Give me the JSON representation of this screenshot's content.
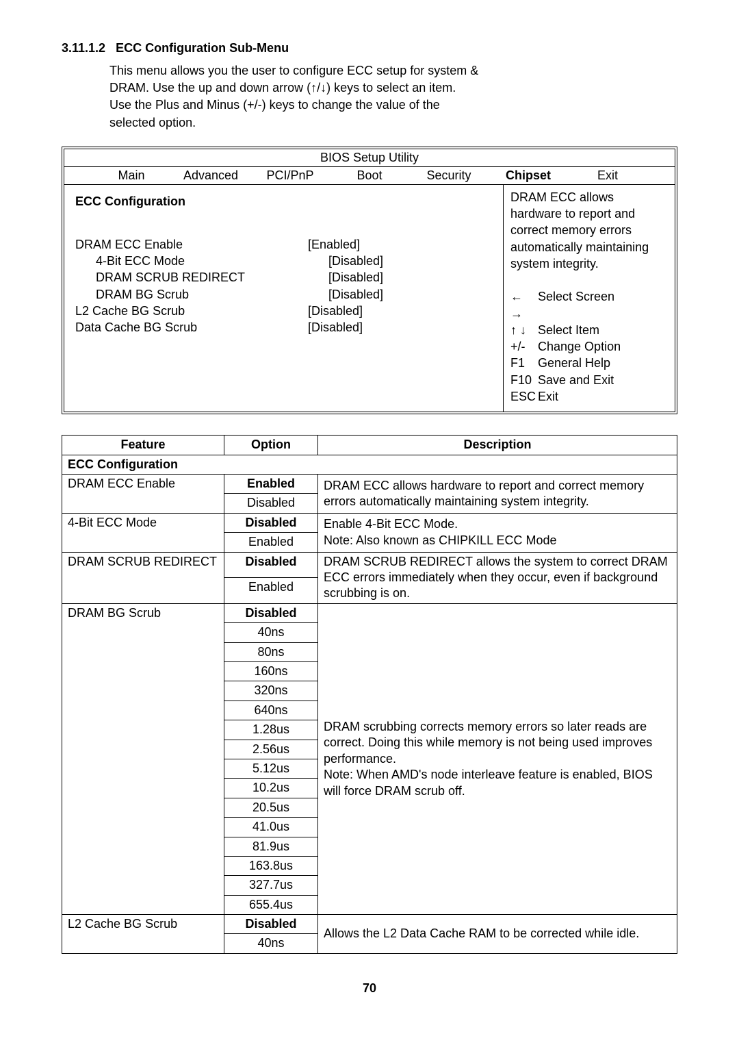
{
  "heading_number": "3.11.1.2",
  "heading_title": "ECC Configuration Sub-Menu",
  "intro_line1": "This menu allows you the user to configure ECC setup for system &",
  "intro_line2a": "DRAM. Use the up and down arrow (",
  "intro_line2b": ") keys to select an item.",
  "intro_line3": "Use the Plus and Minus (+/-) keys to change the value of the",
  "intro_line4": "selected option.",
  "bios_title": "BIOS Setup Utility",
  "menu": {
    "main": "Main",
    "advanced": "Advanced",
    "pcipnp": "PCI/PnP",
    "boot": "Boot",
    "security": "Security",
    "chipset": "Chipset",
    "exit": "Exit"
  },
  "panel_section": "ECC Configuration",
  "options": [
    {
      "label": "DRAM ECC Enable",
      "value": "[Enabled]",
      "indent": false
    },
    {
      "label": "4-Bit ECC Mode",
      "value": "[Disabled]",
      "indent": true
    },
    {
      "label": "DRAM SCRUB REDIRECT",
      "value": "[Disabled]",
      "indent": true
    },
    {
      "label": "DRAM BG Scrub",
      "value": "[Disabled]",
      "indent": true
    },
    {
      "label": "L2 Cache BG Scrub",
      "value": "[Disabled]",
      "indent": false
    },
    {
      "label": "Data Cache BG Scrub",
      "value": "[Disabled]",
      "indent": false
    }
  ],
  "help_text": "DRAM ECC allows hardware to report and correct memory errors automatically maintaining system integrity.",
  "help_keys": [
    {
      "k": "← →",
      "t": "Select Screen"
    },
    {
      "k": "↑ ↓",
      "t": "Select Item"
    },
    {
      "k": "+/-",
      "t": "Change Option"
    },
    {
      "k": "F1",
      "t": "General Help"
    },
    {
      "k": "F10",
      "t": "Save and Exit"
    },
    {
      "k": "ESC",
      "t": "Exit"
    }
  ],
  "table": {
    "headers": {
      "feature": "Feature",
      "option": "Option",
      "description": "Description"
    },
    "section": "ECC Configuration",
    "rows": [
      {
        "feature": "DRAM ECC Enable",
        "options": [
          "Enabled",
          "Disabled"
        ],
        "option_bold": [
          true,
          false
        ],
        "desc": "DRAM ECC allows hardware to report and correct memory errors automatically maintaining system integrity."
      },
      {
        "feature": "4-Bit ECC Mode",
        "options": [
          "Disabled",
          "Enabled"
        ],
        "option_bold": [
          true,
          false
        ],
        "desc": "Enable 4-Bit ECC Mode.\nNote: Also known as CHIPKILL ECC Mode"
      },
      {
        "feature": "DRAM SCRUB REDIRECT",
        "options": [
          "Disabled",
          "Enabled"
        ],
        "option_bold": [
          true,
          false
        ],
        "desc": "DRAM SCRUB REDIRECT allows the system to correct DRAM ECC errors immediately when they occur, even if background scrubbing is on."
      },
      {
        "feature": "DRAM BG Scrub",
        "options": [
          "Disabled",
          "40ns",
          "80ns",
          "160ns",
          "320ns",
          "640ns",
          "1.28us",
          "2.56us",
          "5.12us",
          "10.2us",
          "20.5us",
          "41.0us",
          "81.9us",
          "163.8us",
          "327.7us",
          "655.4us"
        ],
        "option_bold": [
          true,
          false,
          false,
          false,
          false,
          false,
          false,
          false,
          false,
          false,
          false,
          false,
          false,
          false,
          false,
          false
        ],
        "desc": "DRAM scrubbing corrects memory errors so later reads are correct. Doing this while memory is not being used improves performance.\nNote: When AMD's node interleave feature is enabled, BIOS will force DRAM scrub off."
      },
      {
        "feature": "L2 Cache BG Scrub",
        "options": [
          "Disabled",
          "40ns"
        ],
        "option_bold": [
          true,
          false
        ],
        "desc": "Allows the L2 Data Cache RAM to be corrected while idle."
      }
    ]
  },
  "page_number": "70"
}
